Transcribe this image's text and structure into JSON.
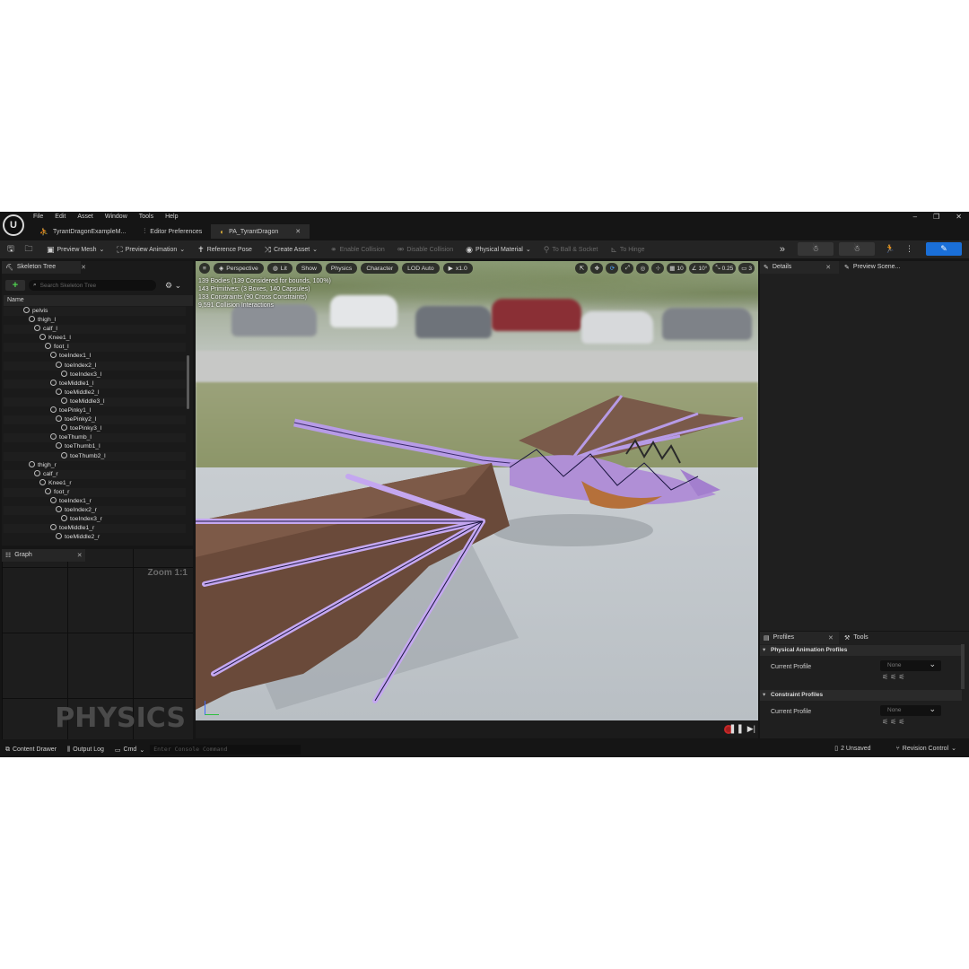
{
  "menu": [
    "File",
    "Edit",
    "Asset",
    "Window",
    "Tools",
    "Help"
  ],
  "doc_tabs": [
    {
      "label": "TyrantDragonExampleM...",
      "icon": "person-icon",
      "active": false
    },
    {
      "label": "Editor Preferences",
      "icon": "sliders-icon",
      "active": false
    },
    {
      "label": "PA_TyrantDragon",
      "icon": "physics-asset-icon",
      "active": true
    }
  ],
  "toolbar": {
    "preview_mesh": "Preview Mesh",
    "preview_animation": "Preview Animation",
    "reference_pose": "Reference Pose",
    "create_asset": "Create Asset",
    "enable_collision": "Enable Collision",
    "disable_collision": "Disable Collision",
    "physical_material": "Physical Material",
    "to_ball_socket": "To Ball & Socket",
    "to_hinge": "To Hinge"
  },
  "skeleton_tree": {
    "tab_label": "Skeleton Tree",
    "search_placeholder": "Search Skeleton Tree",
    "column_name": "Name",
    "bones": [
      {
        "name": "pelvis",
        "depth": 0
      },
      {
        "name": "thigh_l",
        "depth": 1
      },
      {
        "name": "calf_l",
        "depth": 2
      },
      {
        "name": "Knee1_l",
        "depth": 3
      },
      {
        "name": "foot_l",
        "depth": 4
      },
      {
        "name": "toeIndex1_l",
        "depth": 5
      },
      {
        "name": "toeIndex2_l",
        "depth": 6
      },
      {
        "name": "toeIndex3_l",
        "depth": 7
      },
      {
        "name": "toeMiddle1_l",
        "depth": 5
      },
      {
        "name": "toeMiddle2_l",
        "depth": 6
      },
      {
        "name": "toeMiddle3_l",
        "depth": 7
      },
      {
        "name": "toePinky1_l",
        "depth": 5
      },
      {
        "name": "toePinky2_l",
        "depth": 6
      },
      {
        "name": "toePinky3_l",
        "depth": 7
      },
      {
        "name": "toeThumb_l",
        "depth": 5
      },
      {
        "name": "toeThumb1_l",
        "depth": 6
      },
      {
        "name": "toeThumb2_l",
        "depth": 7
      },
      {
        "name": "thigh_r",
        "depth": 1
      },
      {
        "name": "calf_r",
        "depth": 2
      },
      {
        "name": "Knee1_r",
        "depth": 3
      },
      {
        "name": "foot_r",
        "depth": 4
      },
      {
        "name": "toeIndex1_r",
        "depth": 5
      },
      {
        "name": "toeIndex2_r",
        "depth": 6
      },
      {
        "name": "toeIndex3_r",
        "depth": 7
      },
      {
        "name": "toeMiddle1_r",
        "depth": 5
      },
      {
        "name": "toeMiddle2_r",
        "depth": 6
      }
    ]
  },
  "graph": {
    "tab_label": "Graph",
    "zoom": "Zoom 1:1",
    "watermark": "PHYSICS"
  },
  "viewport": {
    "perspective": "Perspective",
    "lit": "Lit",
    "show": "Show",
    "physics": "Physics",
    "character": "Character",
    "lod": "LOD Auto",
    "play_speed": "x1.0",
    "grid_size": "10",
    "rotation_snap": "10°",
    "scale_snap": "0.25",
    "camera_speed": "3",
    "stats": [
      "139 Bodies (139 Considered for bounds, 100%)",
      "143 Primitives: (3 Boxes, 140 Capsules)",
      "133 Constraints (90 Cross Constraints)",
      "9,591 Collision Interactions"
    ]
  },
  "right_panel": {
    "details_tab": "Details",
    "preview_scene_tab": "Preview Scene...",
    "profiles_tab": "Profiles",
    "tools_tab": "Tools",
    "physical_animation_profiles": "Physical Animation Profiles",
    "constraint_profiles": "Constraint Profiles",
    "current_profile_label": "Current Profile",
    "current_profile_value_1": "None",
    "current_profile_value_2": "None"
  },
  "statusbar": {
    "content_drawer": "Content Drawer",
    "output_log": "Output Log",
    "cmd": "Cmd",
    "console_placeholder": "Enter Console Command",
    "unsaved": "2 Unsaved",
    "revision_control": "Revision Control"
  }
}
